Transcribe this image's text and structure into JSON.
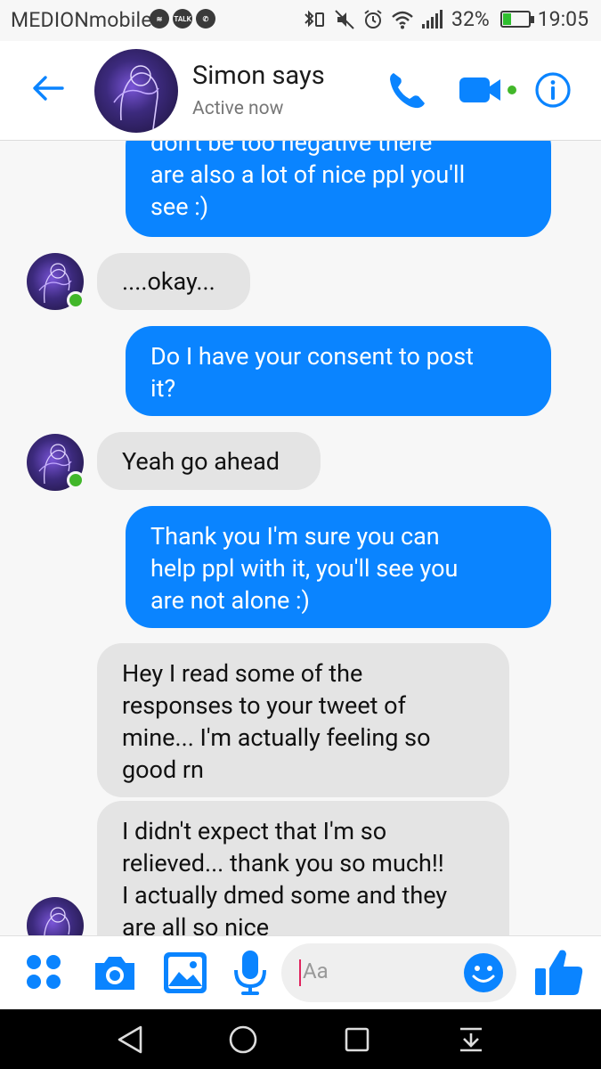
{
  "status_bar": {
    "carrier": "MEDIONmobile",
    "talk_label": "TALK",
    "battery_percent": "32%",
    "battery_level": 0.32,
    "time": "19:05"
  },
  "header": {
    "contact_name": "Simon says",
    "contact_status": "Active now"
  },
  "messages": [
    {
      "direction": "outgoing",
      "lines": [
        "don't be too negative there",
        "are also a lot of nice ppl you'll",
        "see :)"
      ]
    },
    {
      "direction": "incoming",
      "lines": [
        "....okay..."
      ]
    },
    {
      "direction": "outgoing",
      "lines": [
        "Do I have your consent to post",
        "it?"
      ]
    },
    {
      "direction": "incoming",
      "lines": [
        "Yeah go ahead"
      ]
    },
    {
      "direction": "outgoing",
      "lines": [
        "Thank you I'm sure you can",
        "help ppl with it, you'll see you",
        "are not alone :)"
      ]
    },
    {
      "direction": "incoming",
      "lines": [
        "Hey I read some of the",
        "responses to your tweet of",
        "mine... I'm actually feeling so",
        "good rn"
      ]
    },
    {
      "direction": "incoming",
      "lines": [
        "I didn't expect that I'm so",
        "relieved... thank you so much!!",
        "I actually dmed some and they",
        "are all so nice"
      ]
    }
  ],
  "composer": {
    "placeholder": "Aa"
  },
  "colors": {
    "accent": "#0a84ff",
    "incoming_bubble": "#e4e4e4",
    "online": "#42b72a"
  }
}
